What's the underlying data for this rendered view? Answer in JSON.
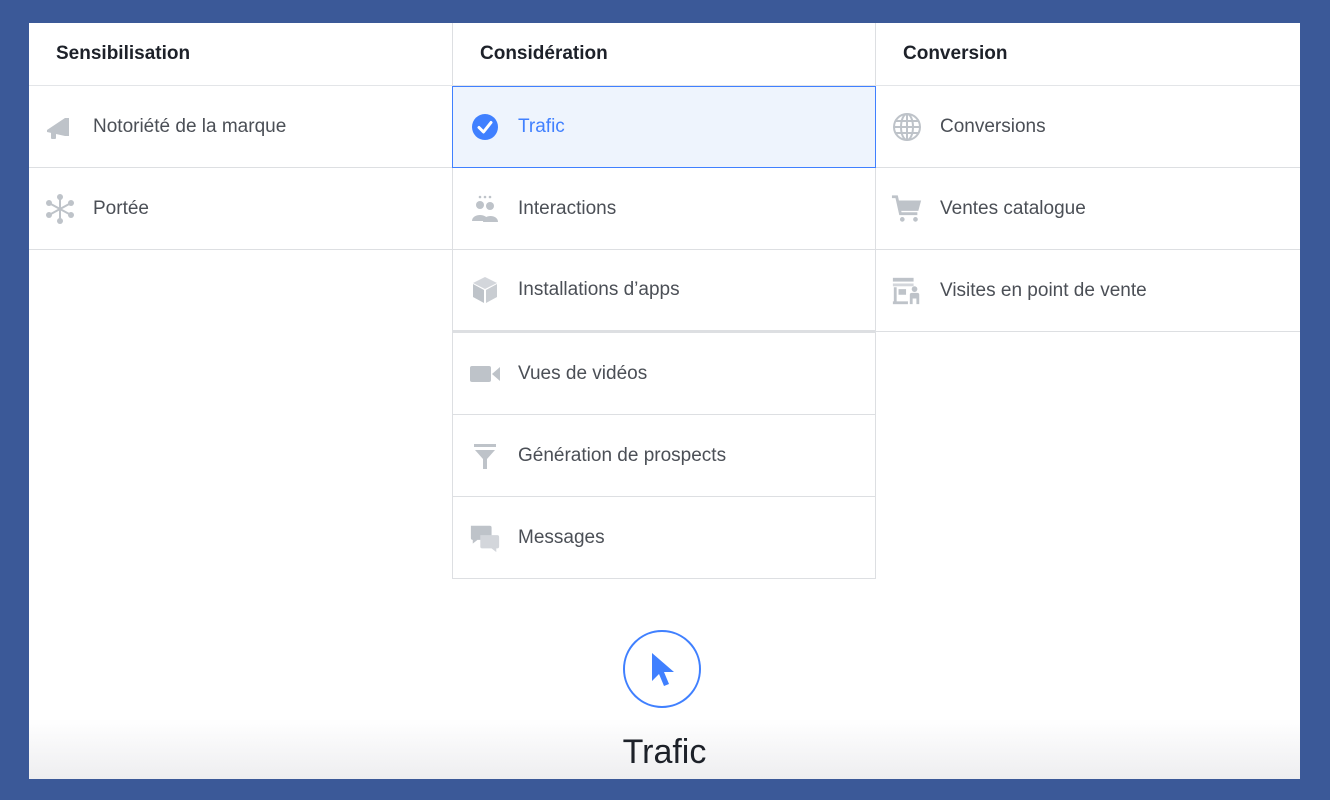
{
  "columns": [
    {
      "header": "Sensibilisation",
      "items": [
        {
          "label": "Notoriété de la marque",
          "icon": "megaphone-icon"
        },
        {
          "label": "Portée",
          "icon": "reach-icon"
        }
      ]
    },
    {
      "header": "Considération",
      "items": [
        {
          "label": "Trafic",
          "icon": "checkmark-icon",
          "selected": true
        },
        {
          "label": "Interactions",
          "icon": "people-icon"
        },
        {
          "label": "Installations d’apps",
          "icon": "box-icon"
        },
        {
          "label": "Vues de vidéos",
          "icon": "video-camera-icon"
        },
        {
          "label": "Génération de prospects",
          "icon": "funnel-icon"
        },
        {
          "label": "Messages",
          "icon": "chat-bubbles-icon"
        }
      ]
    },
    {
      "header": "Conversion",
      "items": [
        {
          "label": "Conversions",
          "icon": "globe-icon"
        },
        {
          "label": "Ventes catalogue",
          "icon": "cart-icon"
        },
        {
          "label": "Visites en point de vente",
          "icon": "store-visit-icon"
        }
      ]
    }
  ],
  "detail": {
    "icon": "cursor-icon",
    "title": "Trafic"
  },
  "colors": {
    "background": "#3b5998",
    "accent": "#4080ff",
    "selected_bg": "#eef4fd",
    "icon_gray": "#bec3c9"
  }
}
